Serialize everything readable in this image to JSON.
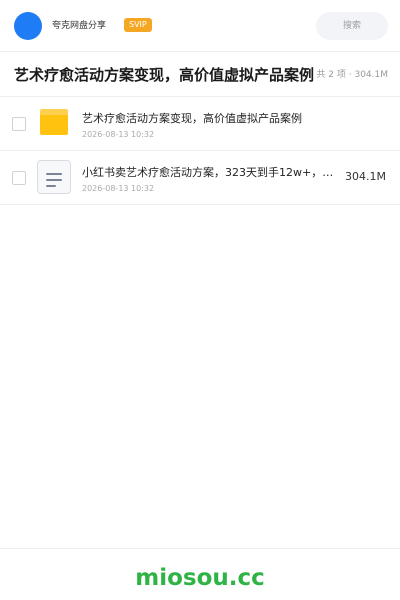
{
  "header": {
    "brand": "夸克网盘分享",
    "badge": "SVIP",
    "search_placeholder": "搜索"
  },
  "folder": {
    "title": "艺术疗愈活动方案变现，高价值虚拟产品案例",
    "meta": "共 2 项 · 304.1M"
  },
  "files": [
    {
      "icon": "folder-icon",
      "name": "艺术疗愈活动方案变现，高价值虚拟产品案例",
      "date": "2026-08-13 10:32",
      "size": ""
    },
    {
      "icon": "document-icon",
      "name": "小红书卖艺术疗愈活动方案，323天到手12w+，有…",
      "date": "2026-08-13 10:32",
      "size": "304.1M"
    }
  ],
  "footer": {
    "watermark": "miosou.cc"
  },
  "colors": {
    "accent": "#1e7df5",
    "badge": "#f5a623",
    "folder": "#ffc20e",
    "watermark": "#2fb344"
  }
}
